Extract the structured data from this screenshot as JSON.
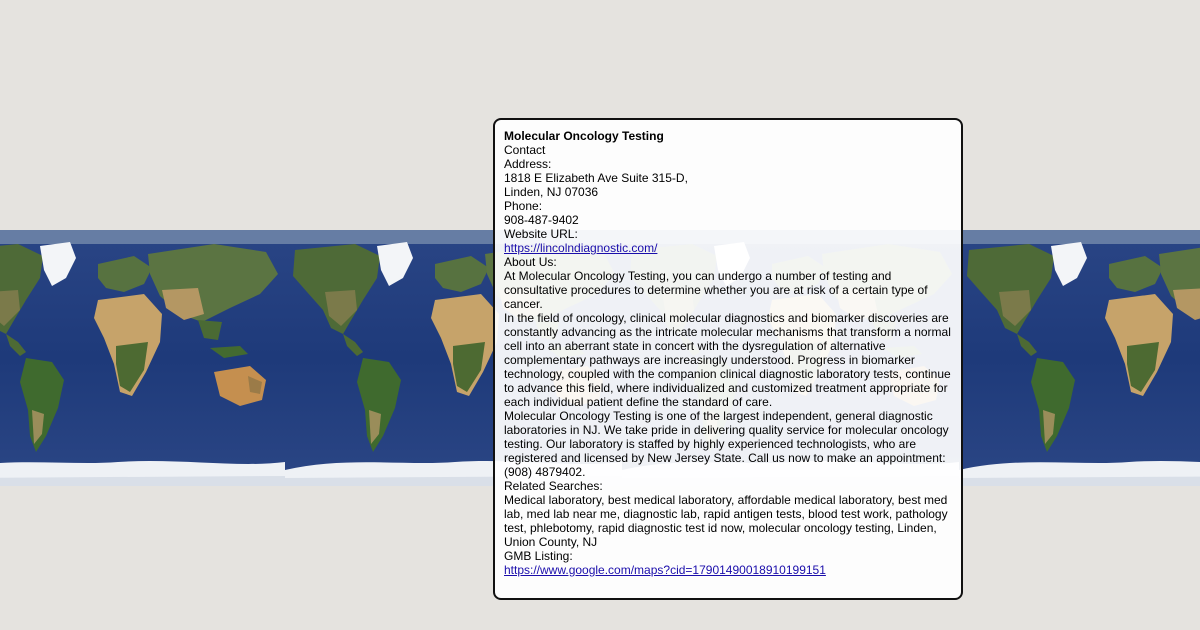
{
  "colors": {
    "page_background": "#e5e3df",
    "ocean": "#1f3a78",
    "land_green": "#4f6b36",
    "land_desert": "#c7a46b",
    "ice": "#f2f4f7",
    "link": "#1a0dab"
  },
  "map": {
    "tiles": [
      "map-tile-1",
      "map-tile-2",
      "map-tile-3",
      "map-tile-4"
    ]
  },
  "info": {
    "title": "Molecular Oncology Testing",
    "contact_label": "Contact",
    "address_label": "Address:",
    "address_line1": "1818 E Elizabeth Ave Suite 315-D,",
    "address_line2": "Linden, NJ 07036",
    "phone_label": "Phone:",
    "phone": "908-487-9402",
    "website_label": "Website URL:",
    "website_url": "https://lincolndiagnostic.com/",
    "about_label": "About Us:",
    "about_p1": "At Molecular Oncology Testing, you can undergo a number of testing and consultative procedures to determine whether you are at risk of a certain type of cancer.",
    "about_p2": "In the field of oncology, clinical molecular diagnostics and biomarker discoveries are constantly advancing as the intricate molecular mechanisms that transform a normal cell into an aberrant state in concert with the dysregulation of alternative complementary pathways are increasingly understood. Progress in biomarker technology, coupled with the companion clinical diagnostic laboratory tests, continue to advance this field, where individualized and customized treatment appropriate for each individual patient define the standard of care.",
    "about_p3": "Molecular Oncology Testing is one of the largest independent, general diagnostic laboratories in NJ. We take pride in delivering quality service for molecular oncology testing. Our laboratory is staffed by highly experienced technologists, who are registered and licensed by New Jersey State. Call us now to make an appointment: (908) 4879402.",
    "related_label": "Related Searches:",
    "related_text": "Medical laboratory, best medical laboratory, affordable medical laboratory, best med lab, med lab near me, diagnostic lab, rapid antigen tests, blood test work, pathology test, phlebotomy, rapid diagnostic test id now, molecular oncology testing, Linden, Union County, NJ",
    "gmb_label": "GMB Listing:",
    "gmb_url": "https://www.google.com/maps?cid=17901490018910199151"
  }
}
